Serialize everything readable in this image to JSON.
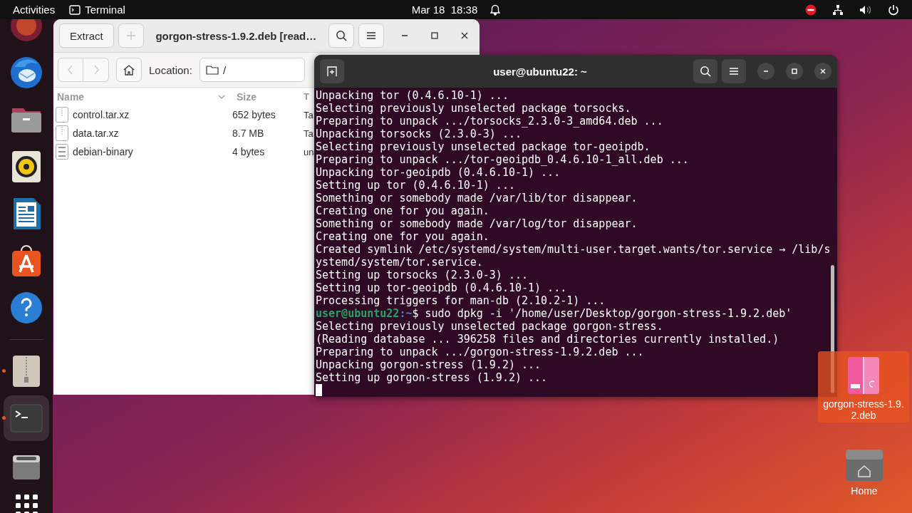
{
  "top_bar": {
    "activities": "Activities",
    "app_name": "Terminal",
    "clock": "Mar 18  18:38"
  },
  "dock": {
    "favorites": [
      {
        "kind": "browser"
      },
      {
        "kind": "mail"
      },
      {
        "kind": "files"
      },
      {
        "kind": "music"
      },
      {
        "kind": "writer"
      },
      {
        "kind": "store"
      },
      {
        "kind": "help"
      }
    ],
    "open_apps": [
      {
        "kind": "archive",
        "running": true,
        "selected": false
      },
      {
        "kind": "terminal",
        "running": true,
        "selected": true
      },
      {
        "kind": "drive",
        "running": false,
        "selected": false
      }
    ]
  },
  "file_roller": {
    "extract": "Extract",
    "add_disabled": true,
    "title": "gorgon-stress-1.9.2.deb [read…",
    "back_disabled": true,
    "forward_disabled": true,
    "location_label": "Location:",
    "location": "/",
    "columns": [
      {
        "label": "Name",
        "sorted": true
      },
      {
        "label": "Size",
        "sorted": false
      },
      {
        "label": "T",
        "sorted": false
      }
    ],
    "rows": [
      {
        "kind": "archive",
        "name": "control.tar.xz",
        "size": "652 bytes",
        "type": "Ta"
      },
      {
        "kind": "archive",
        "name": "data.tar.xz",
        "size": "8.7 MB",
        "type": "Ta"
      },
      {
        "kind": "binary",
        "name": "debian-binary",
        "size": "4 bytes",
        "type": "un"
      }
    ]
  },
  "terminal": {
    "title": "user@ubuntu22: ~",
    "lines": [
      {
        "kind": "output",
        "text": "Unpacking tor (0.4.6.10-1) ..."
      },
      {
        "kind": "output",
        "text": "Selecting previously unselected package torsocks."
      },
      {
        "kind": "output",
        "text": "Preparing to unpack .../torsocks_2.3.0-3_amd64.deb ..."
      },
      {
        "kind": "output",
        "text": "Unpacking torsocks (2.3.0-3) ..."
      },
      {
        "kind": "output",
        "text": "Selecting previously unselected package tor-geoipdb."
      },
      {
        "kind": "output",
        "text": "Preparing to unpack .../tor-geoipdb_0.4.6.10-1_all.deb ..."
      },
      {
        "kind": "output",
        "text": "Unpacking tor-geoipdb (0.4.6.10-1) ..."
      },
      {
        "kind": "output",
        "text": "Setting up tor (0.4.6.10-1) ..."
      },
      {
        "kind": "output",
        "text": "Something or somebody made /var/lib/tor disappear."
      },
      {
        "kind": "output",
        "text": "Creating one for you again."
      },
      {
        "kind": "output",
        "text": "Something or somebody made /var/log/tor disappear."
      },
      {
        "kind": "output",
        "text": "Creating one for you again."
      },
      {
        "kind": "output",
        "text": "Created symlink /etc/systemd/system/multi-user.target.wants/tor.service → /lib/s"
      },
      {
        "kind": "output",
        "text": "ystemd/system/tor.service."
      },
      {
        "kind": "output",
        "text": "Setting up torsocks (2.3.0-3) ..."
      },
      {
        "kind": "output",
        "text": "Setting up tor-geoipdb (0.4.6.10-1) ..."
      },
      {
        "kind": "output",
        "text": "Processing triggers for man-db (2.10.2-1) ..."
      },
      {
        "kind": "prompt",
        "user": "user@ubuntu22",
        "path": ":~",
        "command": "$ sudo dpkg -i '/home/user/Desktop/gorgon-stress-1.9.2.deb'"
      },
      {
        "kind": "output",
        "text": "Selecting previously unselected package gorgon-stress."
      },
      {
        "kind": "output",
        "text": "(Reading database ... 396258 files and directories currently installed.)"
      },
      {
        "kind": "output",
        "text": "Preparing to unpack .../gorgon-stress-1.9.2.deb ..."
      },
      {
        "kind": "output",
        "text": "Unpacking gorgon-stress (1.9.2) ..."
      },
      {
        "kind": "output",
        "text": "Setting up gorgon-stress (1.9.2) ..."
      },
      {
        "kind": "cursor"
      }
    ]
  },
  "desktop_icons": [
    {
      "kind": "deb",
      "label": "gorgon-stress-1.9.2.deb",
      "selected": true
    },
    {
      "kind": "home",
      "label": "Home",
      "selected": false
    }
  ]
}
